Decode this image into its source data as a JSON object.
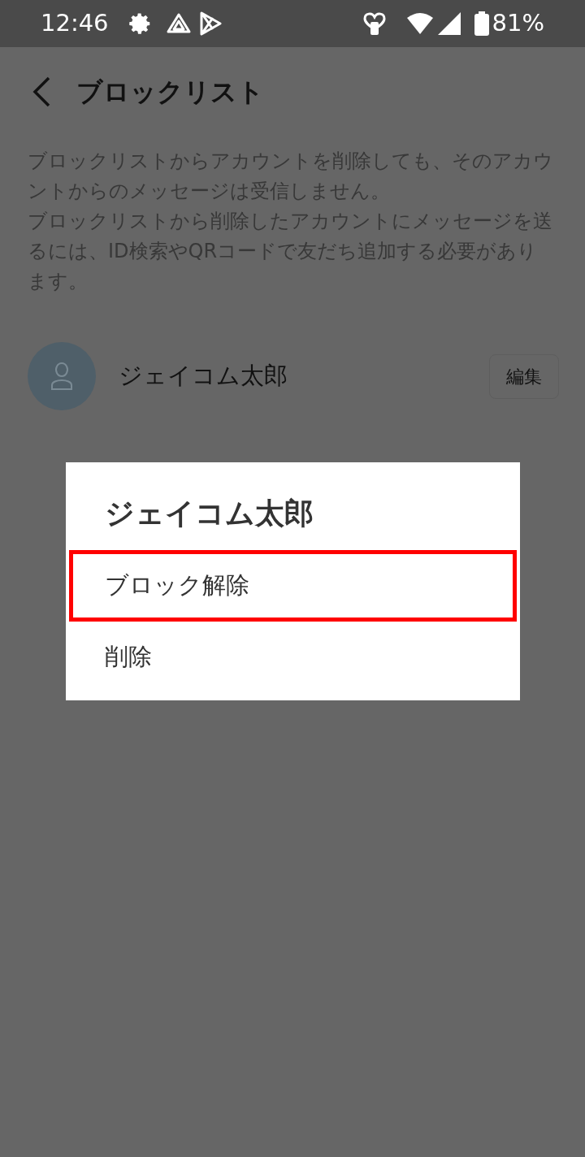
{
  "status_bar": {
    "time": "12:46",
    "battery": "81%"
  },
  "header": {
    "title": "ブロックリスト"
  },
  "description": [
    "ブロックリストからアカウントを削除しても、そのアカウントからのメッセージは受信しません。",
    "ブロックリストから削除したアカウントにメッセージを送るには、ID検索やQRコードで友だち追加する必要があります。"
  ],
  "blocked_accounts": [
    {
      "name": "ジェイコム太郎",
      "button": "編集"
    }
  ],
  "dialog": {
    "title": "ジェイコム太郎",
    "items": [
      {
        "label": "ブロック解除",
        "highlighted": true
      },
      {
        "label": "削除",
        "highlighted": false
      }
    ]
  }
}
